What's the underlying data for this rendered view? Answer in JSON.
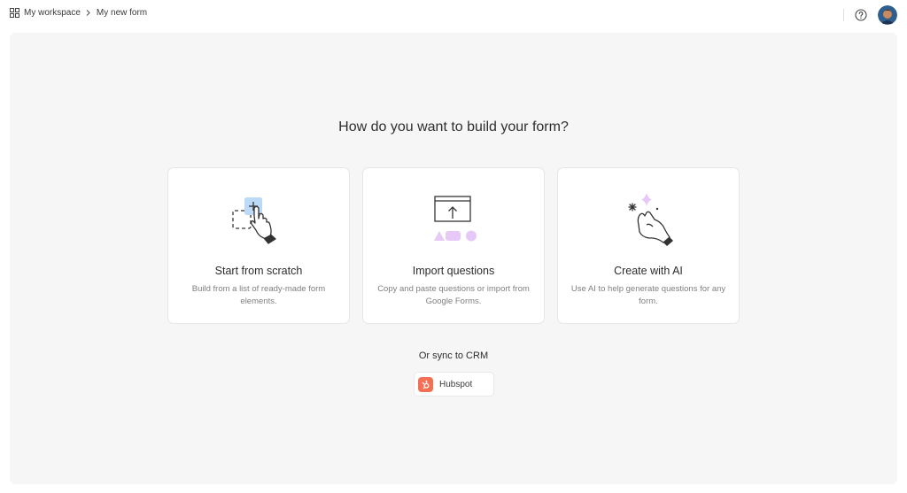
{
  "breadcrumb": {
    "workspace": "My workspace",
    "separator_icon": "chevron-right-icon",
    "current": "My new form"
  },
  "toolbar": {
    "help_icon": "question-circle-icon",
    "avatar_icon": "user-avatar"
  },
  "main": {
    "heading": "How do you want to build your form?",
    "options": [
      {
        "icon": "drag-drop-hand-icon",
        "title": "Start from scratch",
        "description": "Build from a list of ready-made form elements."
      },
      {
        "icon": "upload-shapes-icon",
        "title": "Import questions",
        "description": "Copy and paste questions or import from Google Forms."
      },
      {
        "icon": "sparkle-hand-icon",
        "title": "Create with AI",
        "description": "Use AI to help generate questions for any form."
      }
    ],
    "sync_label": "Or sync to CRM",
    "crm": {
      "icon": "hubspot-logo-icon",
      "label": "Hubspot"
    }
  },
  "colors": {
    "accent_blue": "#bcd9f7",
    "accent_purple": "#e6c9f7",
    "hubspot_orange": "#f56f55",
    "canvas_bg": "#f6f6f6"
  }
}
